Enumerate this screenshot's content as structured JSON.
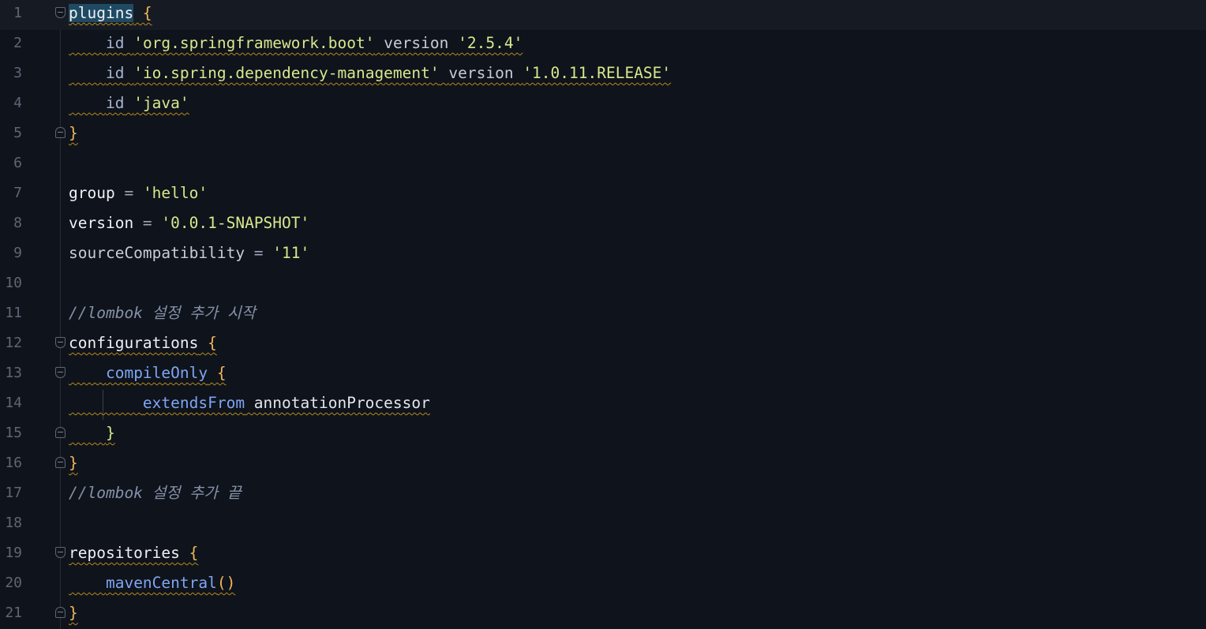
{
  "editor": {
    "language": "gradle",
    "current_line": 1,
    "lines": [
      {
        "n": "1",
        "a": "plugins",
        "b": " {"
      },
      {
        "n": "2",
        "id_kw": "id",
        "s1": "'org.springframework.boot'",
        "v_kw": "version",
        "s2": "'2.5.4'"
      },
      {
        "n": "3",
        "id_kw": "id",
        "s1": "'io.spring.dependency-management'",
        "v_kw": "version",
        "s2": "'1.0.11.RELEASE'"
      },
      {
        "n": "4",
        "id_kw": "id",
        "s1": "'java'"
      },
      {
        "n": "5",
        "a": "}"
      },
      {
        "n": "6"
      },
      {
        "n": "7",
        "a": "group",
        "op": " = ",
        "s": "'hello'"
      },
      {
        "n": "8",
        "a": "version",
        "op": " = ",
        "s": "'0.0.1-SNAPSHOT'"
      },
      {
        "n": "9",
        "a": "sourceCompatibility",
        "op": " = ",
        "s": "'11'"
      },
      {
        "n": "10"
      },
      {
        "n": "11",
        "comment": "//lombok 설정 추가 시작"
      },
      {
        "n": "12",
        "a": "configurations",
        "b": " {"
      },
      {
        "n": "13",
        "a": "compileOnly",
        "b": " {"
      },
      {
        "n": "14",
        "a": "extendsFrom",
        "c": " annotationProcessor"
      },
      {
        "n": "15",
        "a": "}"
      },
      {
        "n": "16",
        "a": "}"
      },
      {
        "n": "17",
        "comment": "//lombok 설정 추가 끝"
      },
      {
        "n": "18"
      },
      {
        "n": "19",
        "a": "repositories",
        "b": " {"
      },
      {
        "n": "20",
        "a": "mavenCentral",
        "b": "()"
      },
      {
        "n": "21",
        "a": "}"
      }
    ]
  },
  "colors": {
    "background": "#0f131b",
    "string": "#d7e88d",
    "brace": "#f0b65b",
    "method": "#7ea6f2",
    "comment": "#8591a9",
    "warning_underline": "#b58b1e"
  },
  "icons": {
    "fold_open": "fold-open-icon",
    "fold_close": "fold-close-icon"
  }
}
